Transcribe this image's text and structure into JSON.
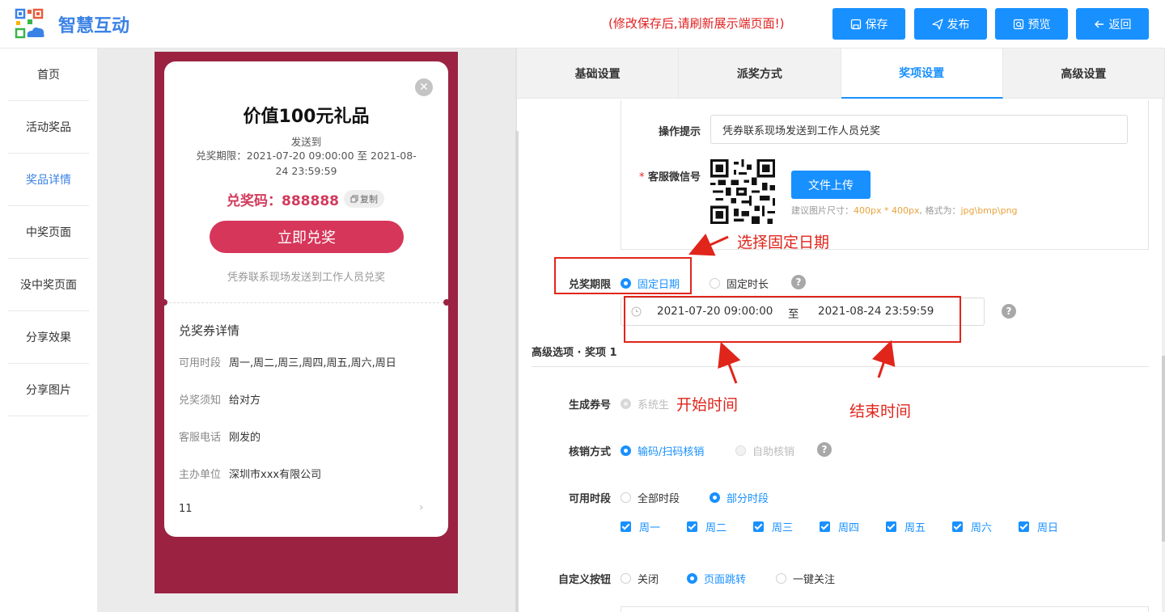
{
  "header": {
    "app_title": "智慧互动",
    "notice": "(修改保存后,请刷新展示端页面!)",
    "buttons": {
      "save": "保存",
      "publish": "发布",
      "preview": "预览",
      "back": "返回"
    }
  },
  "sidebar": {
    "items": [
      {
        "label": "首页"
      },
      {
        "label": "活动奖品"
      },
      {
        "label": "奖品详情"
      },
      {
        "label": "中奖页面"
      },
      {
        "label": "没中奖页面"
      },
      {
        "label": "分享效果"
      },
      {
        "label": "分享图片"
      }
    ],
    "active_index": 2
  },
  "preview": {
    "prize_title": "价值100元礼品",
    "send_to": "发送到",
    "period_prefix": "兑奖期限：",
    "period": "2021-07-20 09:00:00 至 2021-08-24 23:59:59",
    "code_label": "兑奖码：888888",
    "copy_label": "复制",
    "redeem_button": "立即兑奖",
    "hint": "凭券联系现场发送到工作人员兑奖",
    "detail_title": "兑奖券详情",
    "details": [
      {
        "label": "可用时段",
        "value": "周一,周二,周三,周四,周五,周六,周日"
      },
      {
        "label": "兑奖须知",
        "value": "给对方"
      },
      {
        "label": "客服电话",
        "value": "刚发的"
      },
      {
        "label": "主办单位",
        "value": "深圳市xxx有限公司"
      }
    ],
    "extra_row": "11"
  },
  "tabs": [
    {
      "label": "基础设置"
    },
    {
      "label": "派奖方式"
    },
    {
      "label": "奖项设置"
    },
    {
      "label": "高级设置"
    }
  ],
  "active_tab": 2,
  "form": {
    "op_hint_label": "操作提示",
    "op_hint_value": "凭券联系现场发送到工作人员兑奖",
    "wechat_label": "客服微信号",
    "required_mark": "*",
    "upload_button": "文件上传",
    "upload_hint_prefix": "建议图片尺寸：",
    "upload_hint_size": "400px * 400px",
    "upload_hint_mid": ", 格式为：",
    "upload_hint_format": "jpg\\bmp\\png",
    "period_label": "兑奖期限",
    "period_options": [
      "固定日期",
      "固定时长"
    ],
    "date_start": "2021-07-20 09:00:00",
    "date_sep": "至",
    "date_end": "2021-08-24 23:59:59",
    "section_title": "高级选项 · 奖项 1",
    "gen_code_label": "生成券号",
    "gen_code_option": "系统生",
    "verify_label": "核销方式",
    "verify_options": [
      "输码/扫码核销",
      "自助核销"
    ],
    "time_label": "可用时段",
    "time_options": [
      "全部时段",
      "部分时段"
    ],
    "weekdays": [
      "周一",
      "周二",
      "周三",
      "周四",
      "周五",
      "周六",
      "周日"
    ],
    "custom_btn_label": "自定义按钮",
    "custom_btn_options": [
      "关闭",
      "页面跳转",
      "一键关注"
    ]
  },
  "annotations": {
    "select_fixed": "选择固定日期",
    "start_time": "开始时间",
    "end_time": "结束时间"
  },
  "colors": {
    "primary": "#1890ff",
    "accent_red": "#e0251b",
    "phone_bg": "#9b2241",
    "redeem": "#d6365a"
  }
}
